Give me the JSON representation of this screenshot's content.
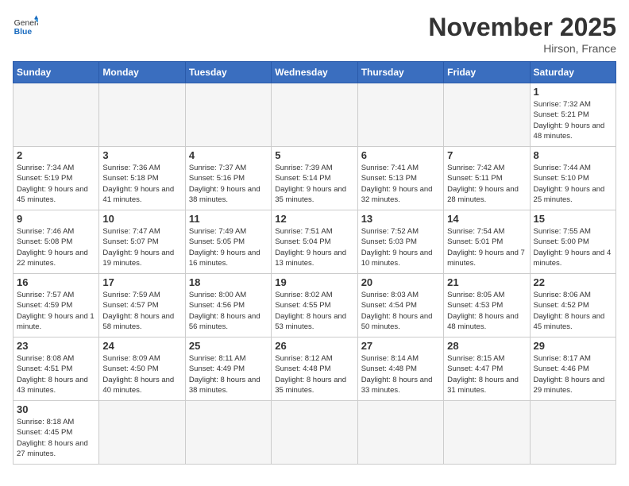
{
  "logo": {
    "text_general": "General",
    "text_blue": "Blue"
  },
  "header": {
    "month_year": "November 2025",
    "location": "Hirson, France"
  },
  "weekdays": [
    "Sunday",
    "Monday",
    "Tuesday",
    "Wednesday",
    "Thursday",
    "Friday",
    "Saturday"
  ],
  "weeks": [
    [
      {
        "day": "",
        "info": ""
      },
      {
        "day": "",
        "info": ""
      },
      {
        "day": "",
        "info": ""
      },
      {
        "day": "",
        "info": ""
      },
      {
        "day": "",
        "info": ""
      },
      {
        "day": "",
        "info": ""
      },
      {
        "day": "1",
        "info": "Sunrise: 7:32 AM\nSunset: 5:21 PM\nDaylight: 9 hours and 48 minutes."
      }
    ],
    [
      {
        "day": "2",
        "info": "Sunrise: 7:34 AM\nSunset: 5:19 PM\nDaylight: 9 hours and 45 minutes."
      },
      {
        "day": "3",
        "info": "Sunrise: 7:36 AM\nSunset: 5:18 PM\nDaylight: 9 hours and 41 minutes."
      },
      {
        "day": "4",
        "info": "Sunrise: 7:37 AM\nSunset: 5:16 PM\nDaylight: 9 hours and 38 minutes."
      },
      {
        "day": "5",
        "info": "Sunrise: 7:39 AM\nSunset: 5:14 PM\nDaylight: 9 hours and 35 minutes."
      },
      {
        "day": "6",
        "info": "Sunrise: 7:41 AM\nSunset: 5:13 PM\nDaylight: 9 hours and 32 minutes."
      },
      {
        "day": "7",
        "info": "Sunrise: 7:42 AM\nSunset: 5:11 PM\nDaylight: 9 hours and 28 minutes."
      },
      {
        "day": "8",
        "info": "Sunrise: 7:44 AM\nSunset: 5:10 PM\nDaylight: 9 hours and 25 minutes."
      }
    ],
    [
      {
        "day": "9",
        "info": "Sunrise: 7:46 AM\nSunset: 5:08 PM\nDaylight: 9 hours and 22 minutes."
      },
      {
        "day": "10",
        "info": "Sunrise: 7:47 AM\nSunset: 5:07 PM\nDaylight: 9 hours and 19 minutes."
      },
      {
        "day": "11",
        "info": "Sunrise: 7:49 AM\nSunset: 5:05 PM\nDaylight: 9 hours and 16 minutes."
      },
      {
        "day": "12",
        "info": "Sunrise: 7:51 AM\nSunset: 5:04 PM\nDaylight: 9 hours and 13 minutes."
      },
      {
        "day": "13",
        "info": "Sunrise: 7:52 AM\nSunset: 5:03 PM\nDaylight: 9 hours and 10 minutes."
      },
      {
        "day": "14",
        "info": "Sunrise: 7:54 AM\nSunset: 5:01 PM\nDaylight: 9 hours and 7 minutes."
      },
      {
        "day": "15",
        "info": "Sunrise: 7:55 AM\nSunset: 5:00 PM\nDaylight: 9 hours and 4 minutes."
      }
    ],
    [
      {
        "day": "16",
        "info": "Sunrise: 7:57 AM\nSunset: 4:59 PM\nDaylight: 9 hours and 1 minute."
      },
      {
        "day": "17",
        "info": "Sunrise: 7:59 AM\nSunset: 4:57 PM\nDaylight: 8 hours and 58 minutes."
      },
      {
        "day": "18",
        "info": "Sunrise: 8:00 AM\nSunset: 4:56 PM\nDaylight: 8 hours and 56 minutes."
      },
      {
        "day": "19",
        "info": "Sunrise: 8:02 AM\nSunset: 4:55 PM\nDaylight: 8 hours and 53 minutes."
      },
      {
        "day": "20",
        "info": "Sunrise: 8:03 AM\nSunset: 4:54 PM\nDaylight: 8 hours and 50 minutes."
      },
      {
        "day": "21",
        "info": "Sunrise: 8:05 AM\nSunset: 4:53 PM\nDaylight: 8 hours and 48 minutes."
      },
      {
        "day": "22",
        "info": "Sunrise: 8:06 AM\nSunset: 4:52 PM\nDaylight: 8 hours and 45 minutes."
      }
    ],
    [
      {
        "day": "23",
        "info": "Sunrise: 8:08 AM\nSunset: 4:51 PM\nDaylight: 8 hours and 43 minutes."
      },
      {
        "day": "24",
        "info": "Sunrise: 8:09 AM\nSunset: 4:50 PM\nDaylight: 8 hours and 40 minutes."
      },
      {
        "day": "25",
        "info": "Sunrise: 8:11 AM\nSunset: 4:49 PM\nDaylight: 8 hours and 38 minutes."
      },
      {
        "day": "26",
        "info": "Sunrise: 8:12 AM\nSunset: 4:48 PM\nDaylight: 8 hours and 35 minutes."
      },
      {
        "day": "27",
        "info": "Sunrise: 8:14 AM\nSunset: 4:48 PM\nDaylight: 8 hours and 33 minutes."
      },
      {
        "day": "28",
        "info": "Sunrise: 8:15 AM\nSunset: 4:47 PM\nDaylight: 8 hours and 31 minutes."
      },
      {
        "day": "29",
        "info": "Sunrise: 8:17 AM\nSunset: 4:46 PM\nDaylight: 8 hours and 29 minutes."
      }
    ],
    [
      {
        "day": "30",
        "info": "Sunrise: 8:18 AM\nSunset: 4:45 PM\nDaylight: 8 hours and 27 minutes."
      },
      {
        "day": "",
        "info": ""
      },
      {
        "day": "",
        "info": ""
      },
      {
        "day": "",
        "info": ""
      },
      {
        "day": "",
        "info": ""
      },
      {
        "day": "",
        "info": ""
      },
      {
        "day": "",
        "info": ""
      }
    ]
  ]
}
